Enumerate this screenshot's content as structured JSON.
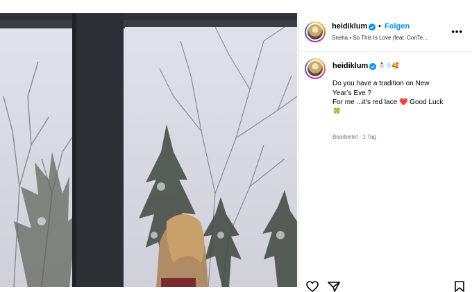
{
  "post_header": {
    "username": "heidiklum",
    "follow_label": "Folgen",
    "separator": "•",
    "song_artist": "Sneha",
    "song_title": "So This Is Love (feat. ConTe..."
  },
  "caption": {
    "username": "heidiklum",
    "emojis": "⛄❄️🥰",
    "lines": [
      "Do you have a tradition on New",
      "Year’s Eve ?",
      "For me ...it’s red lace ❤️ Good Luck",
      "🍀"
    ],
    "meta": "Bearbeitet · 1 Tag"
  },
  "icons": {
    "verified": "verified-badge-icon",
    "more": "more-options-icon",
    "like": "heart-icon",
    "share": "share-icon",
    "save": "bookmark-icon"
  },
  "colors": {
    "accent": "#0095f6",
    "verified": "#0095f6",
    "muted": "#737373"
  }
}
